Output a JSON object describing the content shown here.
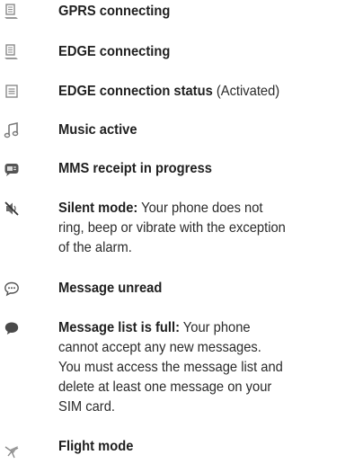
{
  "items": [
    {
      "icon": "gprs-connecting-icon",
      "title": "GPRS connecting",
      "desc": ""
    },
    {
      "icon": "edge-connecting-icon",
      "title": "EDGE connecting",
      "desc": ""
    },
    {
      "icon": "edge-connection-status-icon",
      "title": "EDGE connection status",
      "desc": " (Activated)"
    },
    {
      "icon": "music-note-icon",
      "title": "Music active",
      "desc": ""
    },
    {
      "icon": "mms-receipt-icon",
      "title": "MMS receipt in progress",
      "desc": ""
    },
    {
      "icon": "silent-mode-icon",
      "title": "Silent mode:",
      "desc_lines": [
        " Your phone does not",
        "ring, beep or vibrate with the exception",
        "of the alarm."
      ]
    },
    {
      "icon": "message-unread-icon",
      "title": "Message unread",
      "desc": ""
    },
    {
      "icon": "message-list-full-icon",
      "title": "Message list is full:",
      "desc_lines": [
        " Your phone",
        "cannot accept any new messages.",
        "You must access the message list and",
        "delete at least one message on your",
        "SIM card."
      ]
    },
    {
      "icon": "flight-mode-icon",
      "title": "Flight mode",
      "desc": ""
    }
  ],
  "colors": {
    "text": "#2a2a2a",
    "icon": "#8a8a8a"
  }
}
